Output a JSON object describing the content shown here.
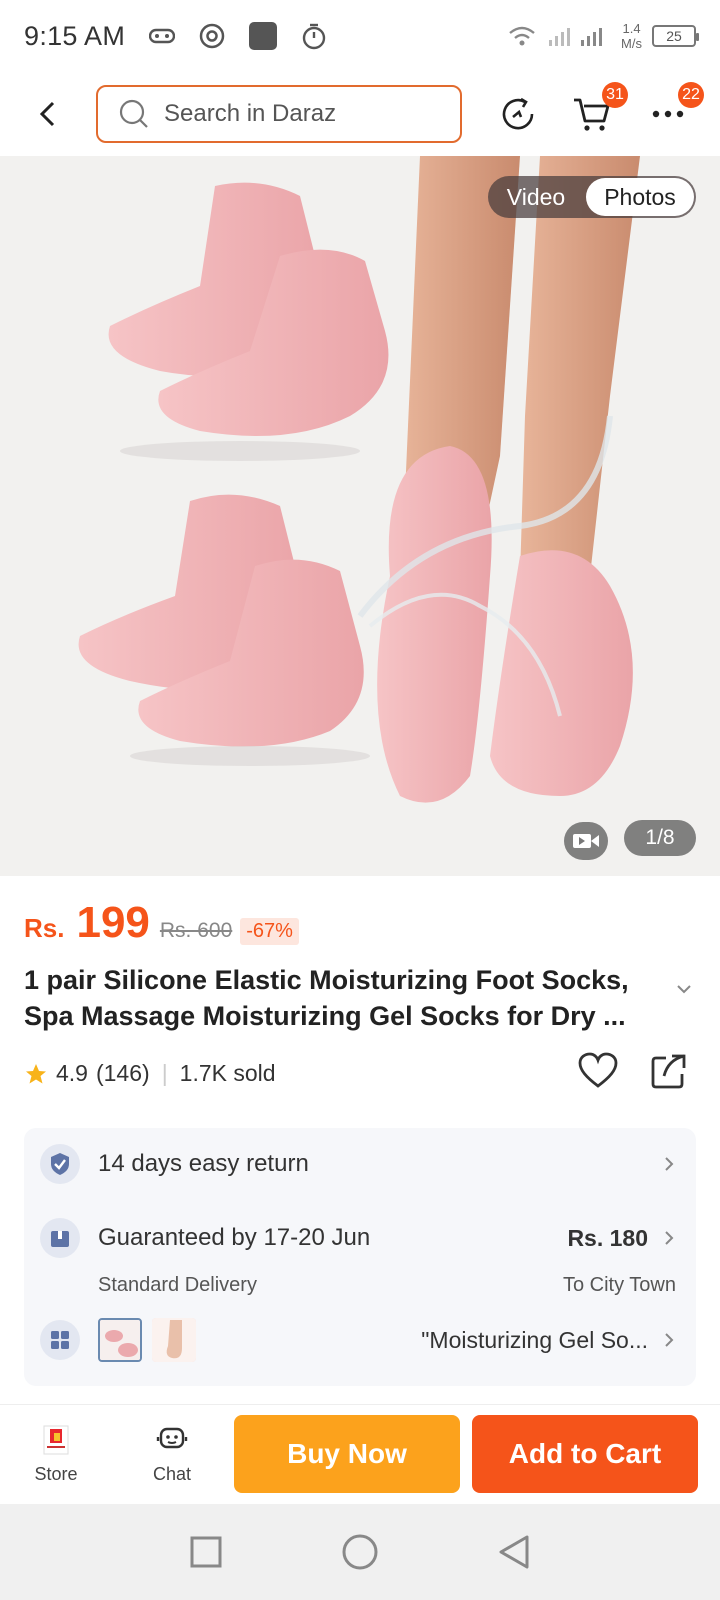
{
  "status_bar": {
    "time": "9:15 AM",
    "net_speed_value": "1.4",
    "net_speed_unit": "M/s",
    "battery": "25"
  },
  "header": {
    "search_placeholder": "Search in Daraz",
    "cart_badge": "31",
    "more_badge": "22",
    "accent_color": "#e26b2e"
  },
  "gallery": {
    "video_label": "Video",
    "photos_label": "Photos",
    "counter": "1/8"
  },
  "price": {
    "currency": "Rs.",
    "value": "199",
    "original": "Rs. 600",
    "discount": "-67%",
    "color": "#f5541a"
  },
  "product": {
    "title_line1": "1 pair Silicone Elastic Moisturizing Foot Socks,",
    "title_line2": "Spa Massage Moisturizing Gel Socks for Dry ...",
    "rating": "4.9",
    "reviews": "(146)",
    "sold": "1.7K sold"
  },
  "info": {
    "returns": "14 days easy return",
    "delivery": "Guaranteed by 17-20 Jun",
    "delivery_type": "Standard Delivery",
    "shipping_price": "Rs. 180",
    "destination": "To City Town",
    "variant": "\"Moisturizing Gel So..."
  },
  "bottom_bar": {
    "store_label": "Store",
    "chat_label": "Chat",
    "buy_now": "Buy Now",
    "add_to_cart": "Add to Cart",
    "buy_color": "#fca21c",
    "cart_color": "#f5541a"
  }
}
